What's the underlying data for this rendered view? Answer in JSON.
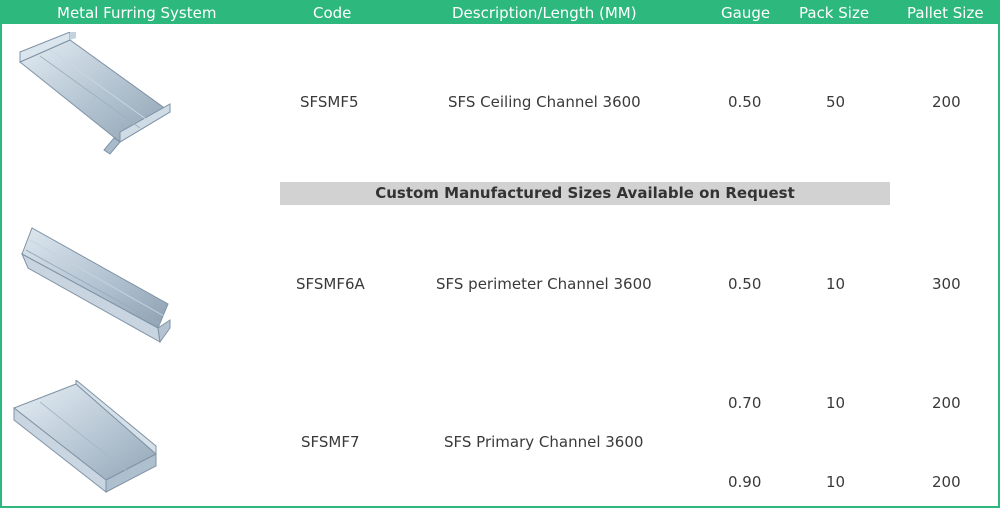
{
  "header": {
    "system": "Metal Furring System",
    "code": "Code",
    "description": "Description/Length (MM)",
    "gauge": "Gauge",
    "pack": "Pack Size",
    "pallet": "Pallet Size"
  },
  "banner": "Custom Manufactured Sizes Available on Request",
  "rows": [
    {
      "image": "ceiling-channel-image",
      "code": "SFSMF5",
      "description": "SFS Ceiling Channel 3600",
      "gauge": "0.50",
      "pack": "50",
      "pallet": "200"
    },
    {
      "image": "perimeter-channel-image",
      "code": "SFSMF6A",
      "description": "SFS perimeter Channel 3600",
      "gauge": "0.50",
      "pack": "10",
      "pallet": "300"
    },
    {
      "image": "primary-channel-image",
      "code": "SFSMF7",
      "description": "SFS Primary Channel 3600",
      "variants": [
        {
          "gauge": "0.70",
          "pack": "10",
          "pallet": "200"
        },
        {
          "gauge": "0.90",
          "pack": "10",
          "pallet": "200"
        }
      ]
    }
  ],
  "colors": {
    "header_bg": "#2db87d",
    "banner_bg": "#d2d2d2",
    "border": "#2db87d",
    "text": "#3a3a3a"
  }
}
